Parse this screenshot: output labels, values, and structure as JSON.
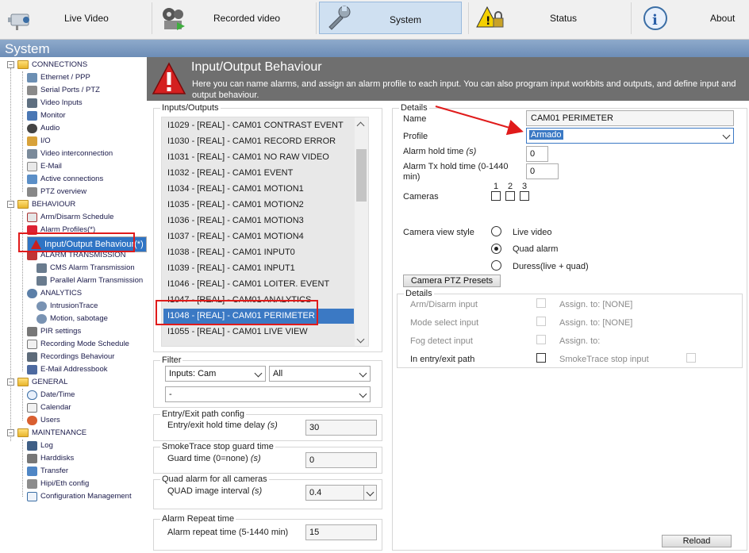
{
  "nav": {
    "tabs": [
      {
        "label": "Live Video",
        "icon": "camera-icon"
      },
      {
        "label": "Recorded video",
        "icon": "film-reel-icon"
      },
      {
        "label": "System",
        "icon": "wrench-icon"
      },
      {
        "label": "Status",
        "icon": "warning-lock-icon"
      },
      {
        "label": "About",
        "icon": "info-icon"
      }
    ]
  },
  "system_title": "System",
  "tree": {
    "groups": [
      {
        "label": "CONNECTIONS",
        "items": [
          "Ethernet / PPP",
          "Serial Ports / PTZ",
          "Video Inputs",
          "Monitor",
          "Audio",
          "I/O",
          "Video interconnection",
          "E-Mail",
          "Active connections",
          "PTZ overview"
        ]
      },
      {
        "label": "BEHAVIOUR",
        "items": [
          "Arm/Disarm Schedule",
          "Alarm Profiles(*)",
          "Input/Output Behaviour(*)",
          "ALARM TRANSMISSION",
          "CMS Alarm Transmission",
          "Parallel Alarm Transmission",
          "ANALYTICS",
          "IntrusionTrace",
          "Motion, sabotage",
          "PIR settings",
          "Recording Mode Schedule",
          "Recordings Behaviour",
          "E-Mail Addressbook"
        ]
      },
      {
        "label": "GENERAL",
        "items": [
          "Date/Time",
          "Calendar",
          "Users"
        ]
      },
      {
        "label": "MAINTENANCE",
        "items": [
          "Log",
          "Harddisks",
          "Transfer",
          "Hipi/Eth config",
          "Configuration Management"
        ]
      }
    ]
  },
  "header": {
    "title": "Input/Output Behaviour",
    "description": "Here you can name alarms, and assign an alarm profile to each input. You can also program input workbits and outputs, and define input and output behaviour."
  },
  "io": {
    "legend": "Inputs/Outputs",
    "rows": [
      "I1029 - [REAL] - CAM01 CONTRAST EVENT",
      "I1030 - [REAL] - CAM01 RECORD ERROR",
      "I1031 - [REAL] - CAM01 NO RAW VIDEO",
      "I1032 - [REAL] - CAM01 EVENT",
      "I1034 - [REAL] - CAM01 MOTION1",
      "I1035 - [REAL] - CAM01 MOTION2",
      "I1036 - [REAL] - CAM01 MOTION3",
      "I1037 - [REAL] - CAM01 MOTION4",
      "I1038 - [REAL] - CAM01 INPUT0",
      "I1039 - [REAL] - CAM01 INPUT1",
      "I1046 - [REAL] - CAM01 LOITER. EVENT",
      "I1047 - [REAL] - CAM01 ANALYTICS",
      "I1048 - [REAL] - CAM01 PERIMETER",
      "I1055 - [REAL] - CAM01 LIVE VIEW"
    ],
    "selected": "I1048 - [REAL] - CAM01 PERIMETER"
  },
  "filter": {
    "legend": "Filter",
    "type_value": "Inputs: Cam",
    "scope_value": "All",
    "third_value": "-"
  },
  "entry_exit": {
    "legend": "Entry/Exit path config",
    "label": "Entry/exit hold time delay",
    "unit": "(s)",
    "value": "30"
  },
  "smoketrace": {
    "legend": "SmokeTrace stop guard time",
    "label": "Guard time (0=none)",
    "unit": "(s)",
    "value": "0"
  },
  "quad": {
    "legend": "Quad alarm for all cameras",
    "label": "QUAD image interval",
    "unit": "(s)",
    "value": "0.4"
  },
  "repeat": {
    "legend": "Alarm Repeat time",
    "label": "Alarm repeat time (5-1440 min)",
    "value": "15"
  },
  "details": {
    "legend": "Details",
    "name_label": "Name",
    "name_value": "CAM01 PERIMETER",
    "profile_label": "Profile",
    "profile_value": "Armado",
    "hold_label": "Alarm hold time",
    "hold_unit": "(s)",
    "hold_value": "0",
    "tx_label": "Alarm Tx hold time (0-1440 min)",
    "tx_value": "0",
    "cameras_label": "Cameras",
    "cameras": [
      "1",
      "2",
      "3"
    ],
    "view_label": "Camera view style",
    "view_options": [
      "Live video",
      "Quad alarm",
      "Duress(live + quad)"
    ],
    "view_selected": "Quad alarm",
    "ptz_button": "Camera PTZ Presets",
    "sub_legend": "Details",
    "arm_label": "Arm/Disarm input",
    "arm_assign": "Assign. to: [NONE]",
    "mode_label": "Mode select input",
    "mode_assign": "Assign. to: [NONE]",
    "fog_label": "Fog detect input",
    "fog_assign": "Assign. to:",
    "entry_label": "In entry/exit path",
    "smoke_label": "SmokeTrace stop input",
    "reload_button": "Reload"
  },
  "colors": {
    "accent": "#3b79c4",
    "annotation": "#e01b1b",
    "header": "#6f6f6f"
  }
}
